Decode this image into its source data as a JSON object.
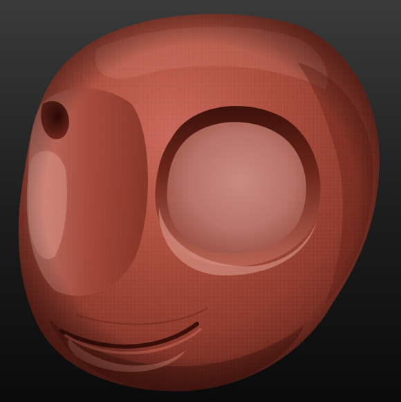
{
  "viewport": {
    "background_top": "#3a3a3a",
    "background_bottom": "#0a0a0a",
    "material_color": "#a8483a",
    "material_highlight": "#d27f70",
    "material_shadow": "#4a1812",
    "wireframe": true
  },
  "model": {
    "icon": "sculpted-head-icon"
  }
}
